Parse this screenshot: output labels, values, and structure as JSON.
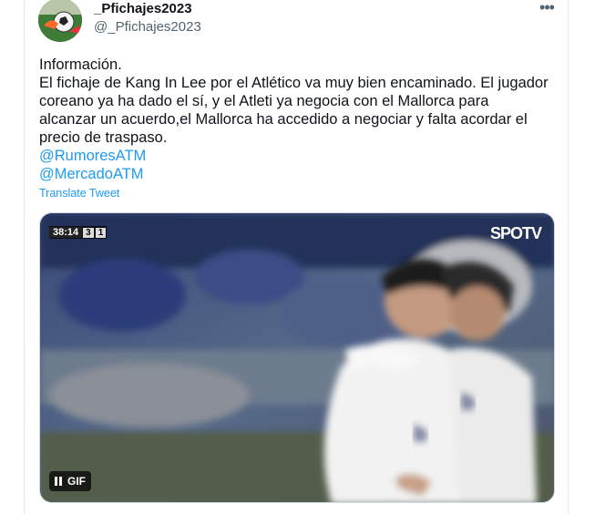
{
  "tweet": {
    "display_name": "_Pfichajes2023",
    "handle": "@_Pfichajes2023",
    "more_icon": "more-icon",
    "text_lines": [
      "Información.",
      "El fichaje de Kang In Lee por el Atlético va muy bien encaminado. El jugador coreano ya ha dado el sí, y el Atleti ya negocia con el Mallorca para alcanzar un acuerdo,el Mallorca ha accedido a negociar y falta acordar el precio de traspaso."
    ],
    "mentions": [
      "@RumoresATM",
      "@MercadoATM"
    ],
    "translate_label": "Translate Tweet"
  },
  "media": {
    "scoreboard": {
      "time": "38:14",
      "home_score": "3",
      "away_score": "1"
    },
    "broadcaster": "SPOTV",
    "gif_label": "GIF"
  },
  "colors": {
    "link": "#1d9bf0",
    "text": "#0f1419",
    "secondary": "#536471"
  }
}
